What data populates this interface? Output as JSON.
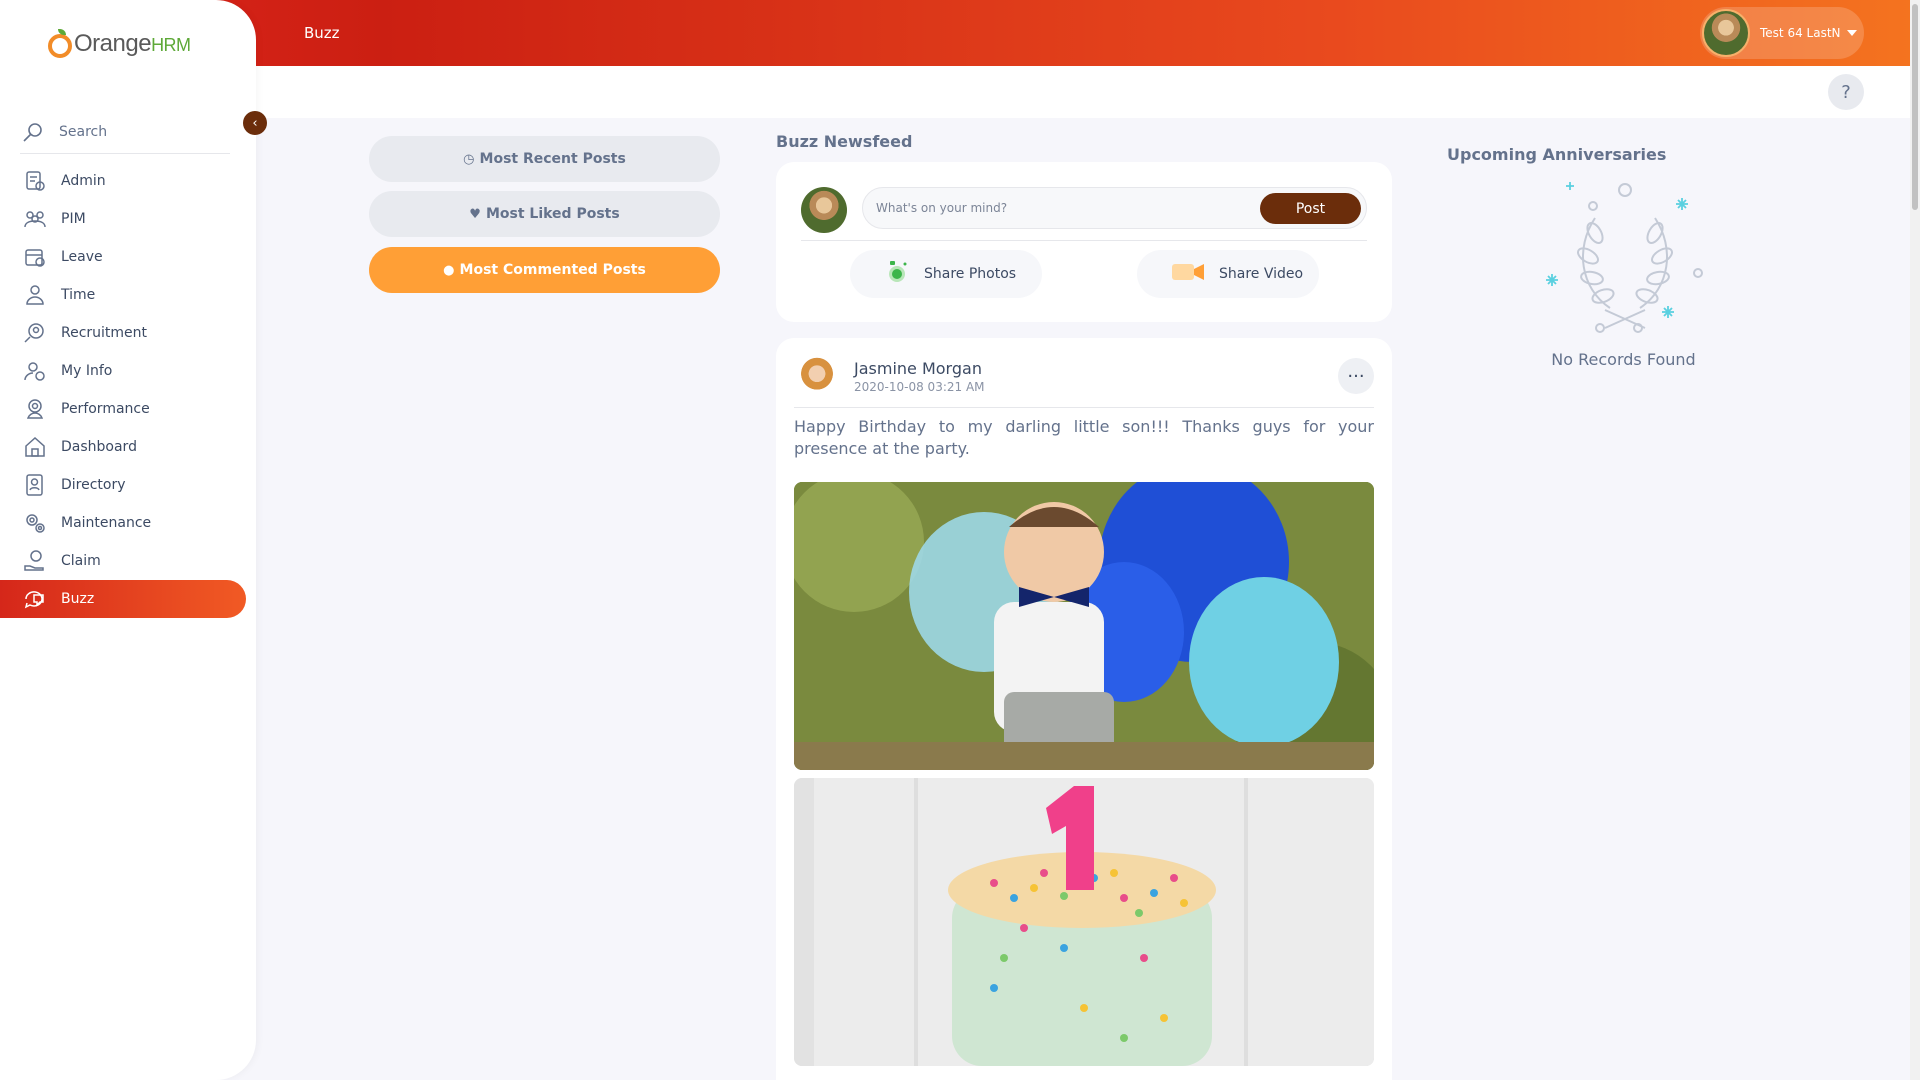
{
  "header": {
    "module_title": "Buzz",
    "user_name": "Test 64 LastN",
    "help_label": "?"
  },
  "sidebar": {
    "brand_orange": "Orange",
    "brand_hrm": "HRM",
    "collapse_icon": "‹",
    "search_label": "Search",
    "items": [
      {
        "label": "Admin",
        "icon": "admin-icon"
      },
      {
        "label": "PIM",
        "icon": "pim-icon"
      },
      {
        "label": "Leave",
        "icon": "leave-icon"
      },
      {
        "label": "Time",
        "icon": "time-icon"
      },
      {
        "label": "Recruitment",
        "icon": "recruitment-icon"
      },
      {
        "label": "My Info",
        "icon": "my-info-icon"
      },
      {
        "label": "Performance",
        "icon": "performance-icon"
      },
      {
        "label": "Dashboard",
        "icon": "dashboard-icon"
      },
      {
        "label": "Directory",
        "icon": "directory-icon"
      },
      {
        "label": "Maintenance",
        "icon": "maintenance-icon"
      },
      {
        "label": "Claim",
        "icon": "claim-icon"
      },
      {
        "label": "Buzz",
        "icon": "buzz-icon",
        "active": true
      }
    ]
  },
  "filters": {
    "most_recent": "Most Recent Posts",
    "most_liked": "Most Liked Posts",
    "most_commented": "Most Commented Posts",
    "active": "most_commented"
  },
  "newsfeed": {
    "title": "Buzz Newsfeed",
    "compose_placeholder": "What's on your mind?",
    "post_button": "Post",
    "share_photos": "Share Photos",
    "share_video": "Share Video"
  },
  "post": {
    "author": "Jasmine Morgan",
    "date": "2020-10-08 03:21 AM",
    "menu_label": "···",
    "text": "Happy Birthday to my darling little son!!! Thanks guys for your presence at the party."
  },
  "anniversaries": {
    "title": "Upcoming Anniversaries",
    "empty_text": "No Records Found"
  },
  "colors": {
    "brand_red": "#d5271a",
    "brand_orange": "#f15a24",
    "filter_active": "#ff9f36",
    "post_button": "#6b2d0b"
  }
}
